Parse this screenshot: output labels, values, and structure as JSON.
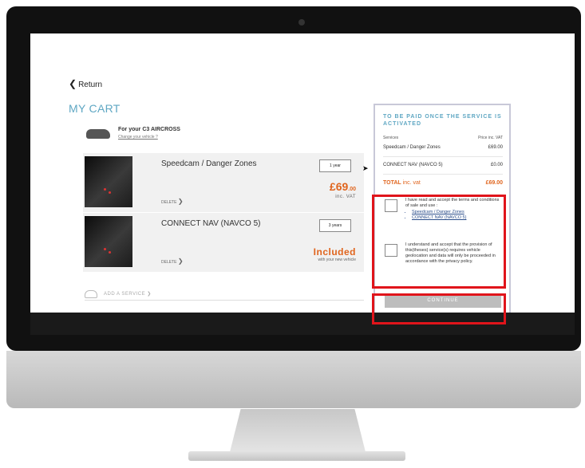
{
  "navigation": {
    "return_label": "Return"
  },
  "cart": {
    "title": "MY CART",
    "vehicle": {
      "for_label": "For your C3 AIRCROSS",
      "change_link": "Change your vehicle ?"
    },
    "items": [
      {
        "name": "Speedcam / Danger Zones",
        "duration": "1 year",
        "price_main": "£69",
        "price_cents": ".00",
        "price_note": "inc. VAT",
        "delete_label": "DELETE"
      },
      {
        "name": "CONNECT NAV (NAVCO 5)",
        "duration": "3 years",
        "included_label": "Included",
        "included_note": "with your new vehicle",
        "delete_label": "DELETE"
      }
    ],
    "add_service_label": "ADD A SERVICE"
  },
  "summary": {
    "heading": "TO BE PAID ONCE THE SERVICE IS ACTIVATED",
    "col_services": "Services",
    "col_price": "Price inc. VAT",
    "rows": [
      {
        "service": "Speedcam / Danger Zones",
        "price": "£69.00"
      },
      {
        "service": "CONNECT NAV (NAVCO 5)",
        "price": "£0.00"
      }
    ],
    "total_bold": "TOTAL",
    "total_label": " inc. vat",
    "total_value": "£69.00",
    "terms_text": "I have read and accept the terms and conditions of sale and use :",
    "terms_links": [
      "Speedcam / Danger Zones",
      "CONNECT NAV (NAVCO 5)"
    ],
    "geo_text": "I understand and accept that the provision of this(theses) service(s) requires vehicle geolocation and data will only be proceeded in accordance with the privacy policy.",
    "continue_label": "CONTINUE"
  },
  "colors": {
    "accent": "#5fa7c3",
    "price": "#e0651e",
    "highlight": "#e0141b"
  }
}
